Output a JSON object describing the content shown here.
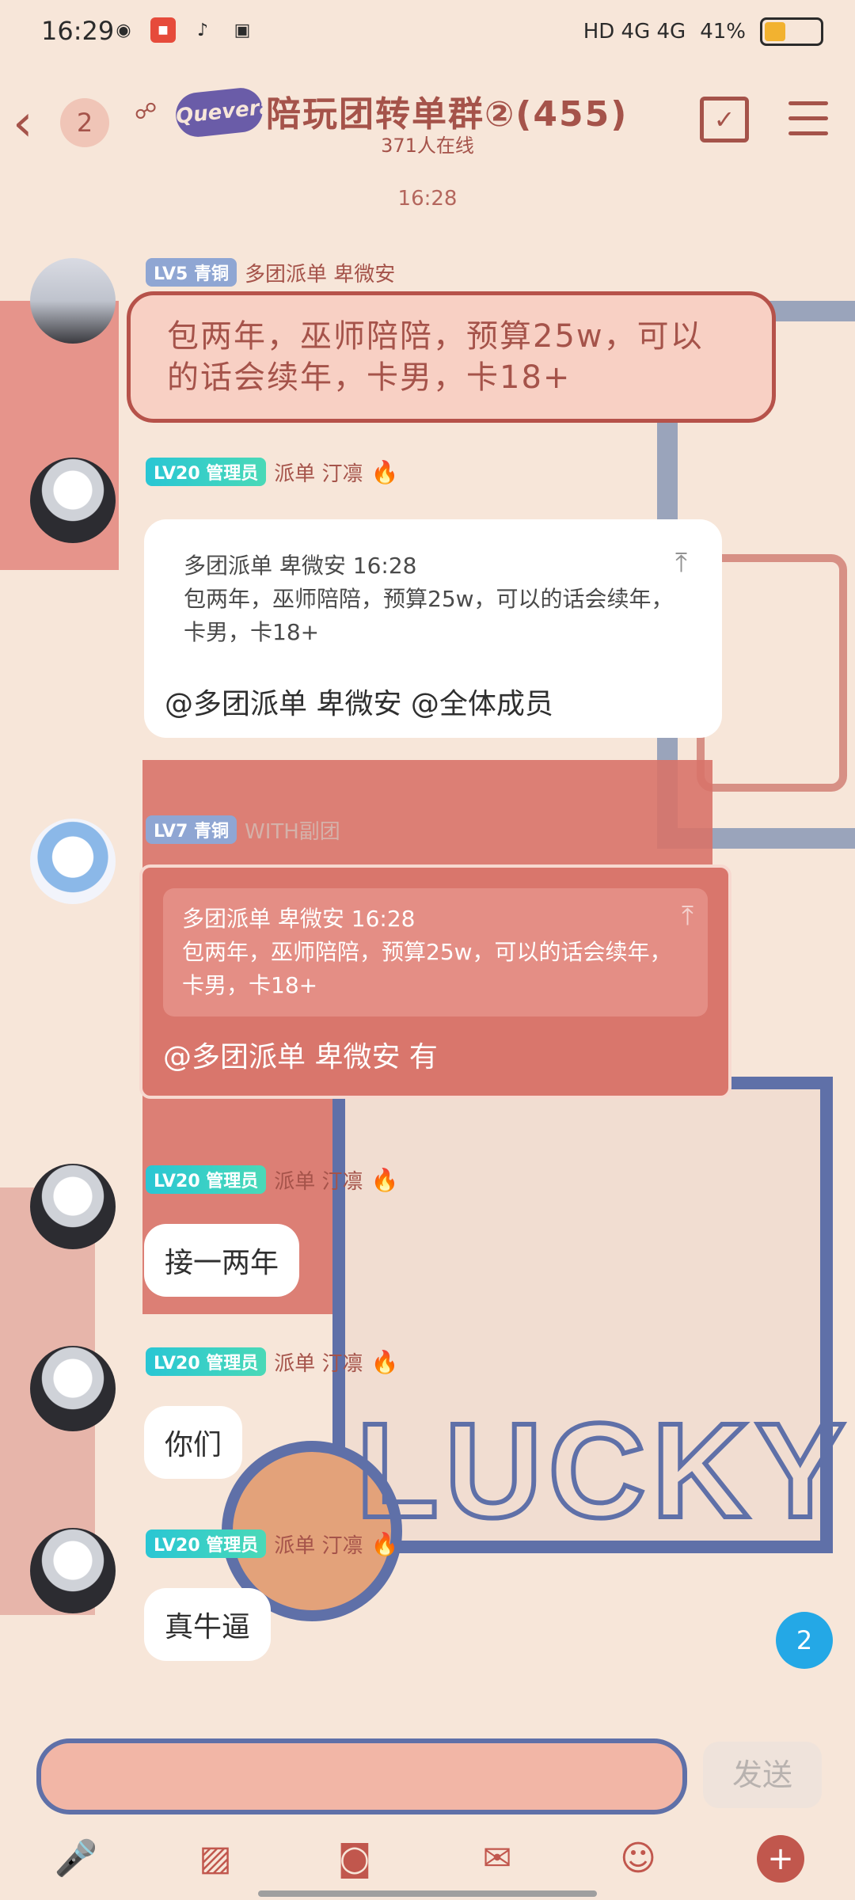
{
  "status_bar": {
    "time": "16:29",
    "icons": [
      "wechat-icon",
      "app-icon",
      "tiktok-icon",
      "tuan-icon"
    ],
    "network": "HD 4G 4G",
    "battery_pct": "41%",
    "battery_fill": 0.41
  },
  "header": {
    "unread_count": "2",
    "logo_text": "Quevera",
    "title": "陪玩团转单群②(455)",
    "online": "371人在线"
  },
  "timestamp": "16:28",
  "messages": [
    {
      "level": "LV5 青铜",
      "nick": "多团派单 卑微安",
      "text": "包两年，巫师陪陪，预算25w，可以的话会续年，卡男，卡18+"
    },
    {
      "level": "LV20 管理员",
      "nick": "派单 汀凛",
      "quote_header": "多团派单 卑微安 16:28",
      "quote_text": "包两年，巫师陪陪，预算25w，可以的话会续年，卡男，卡18+",
      "text": "@多团派单 卑微安 @全体成员"
    },
    {
      "level": "LV7 青铜",
      "nick": "WITH副团",
      "quote_header": "多团派单 卑微安 16:28",
      "quote_text": "包两年，巫师陪陪，预算25w，可以的话会续年，卡男，卡18+",
      "text": "@多团派单 卑微安 有"
    },
    {
      "level": "LV20 管理员",
      "nick": "派单 汀凛",
      "text": "接一两年"
    },
    {
      "level": "LV20 管理员",
      "nick": "派单 汀凛",
      "text": "你们"
    },
    {
      "level": "LV20 管理员",
      "nick": "派单 汀凛",
      "text": "真牛逼"
    }
  ],
  "float_unread": "2",
  "input": {
    "placeholder": ""
  },
  "send_label": "发送",
  "toolbar": [
    "mic-icon",
    "image-icon",
    "camera-icon",
    "red-packet-icon",
    "emoji-icon",
    "plus-icon"
  ],
  "colors": {
    "accent": "#a5534a",
    "admin_badge": "#29c6d4",
    "send_disabled": "#b8b2af"
  }
}
